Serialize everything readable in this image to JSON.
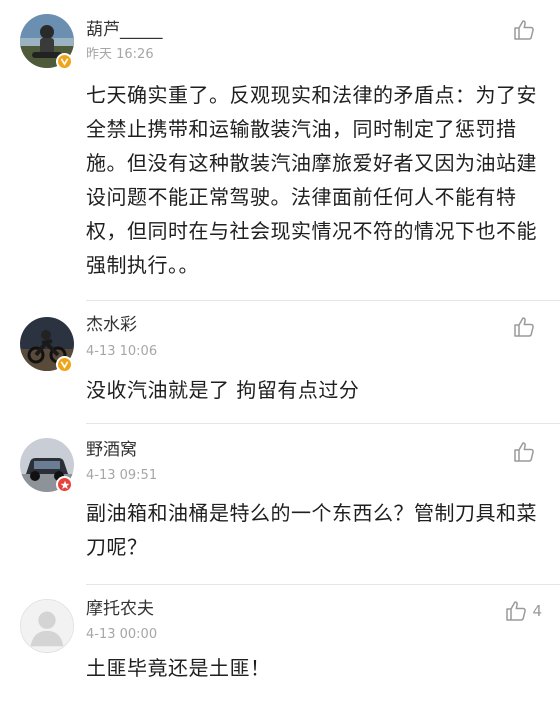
{
  "comments": [
    {
      "username": "葫芦_____",
      "time": "昨天 16:26",
      "text": "七天确实重了。反观现实和法律的矛盾点：为了安全禁止携带和运输散装汽油，同时制定了惩罚措施。但没有这种散装汽油摩旅爱好者又因为油站建设问题不能正常驾驶。法律面前任何人不能有特权，但同时在与社会现实情况不符的情况下也不能强制执行。。",
      "likes": "",
      "avatar_icon": "avatar-rider-icon",
      "badge": "verified-v-badge"
    },
    {
      "username": "杰水彩",
      "time": "4-13 10:06",
      "text": "没收汽油就是了 拘留有点过分",
      "likes": "",
      "avatar_icon": "avatar-motorcycle-icon",
      "badge": "verified-v-badge"
    },
    {
      "username": "野酒窝",
      "time": "4-13 09:51",
      "text": "副油箱和油桶是特么的一个东西么？管制刀具和菜刀呢？",
      "likes": "",
      "avatar_icon": "avatar-car-icon",
      "badge": "star-badge"
    },
    {
      "username": "摩托农夫",
      "time": "4-13 00:00",
      "text": "土匪毕竟还是土匪！",
      "likes": "4",
      "avatar_icon": "default-avatar-icon",
      "badge": ""
    }
  ],
  "colors": {
    "badge_gold": "#f0a419",
    "badge_red": "#e8423a",
    "like_gray": "#9a9a9a"
  },
  "like_icon": "thumbs-up-icon"
}
